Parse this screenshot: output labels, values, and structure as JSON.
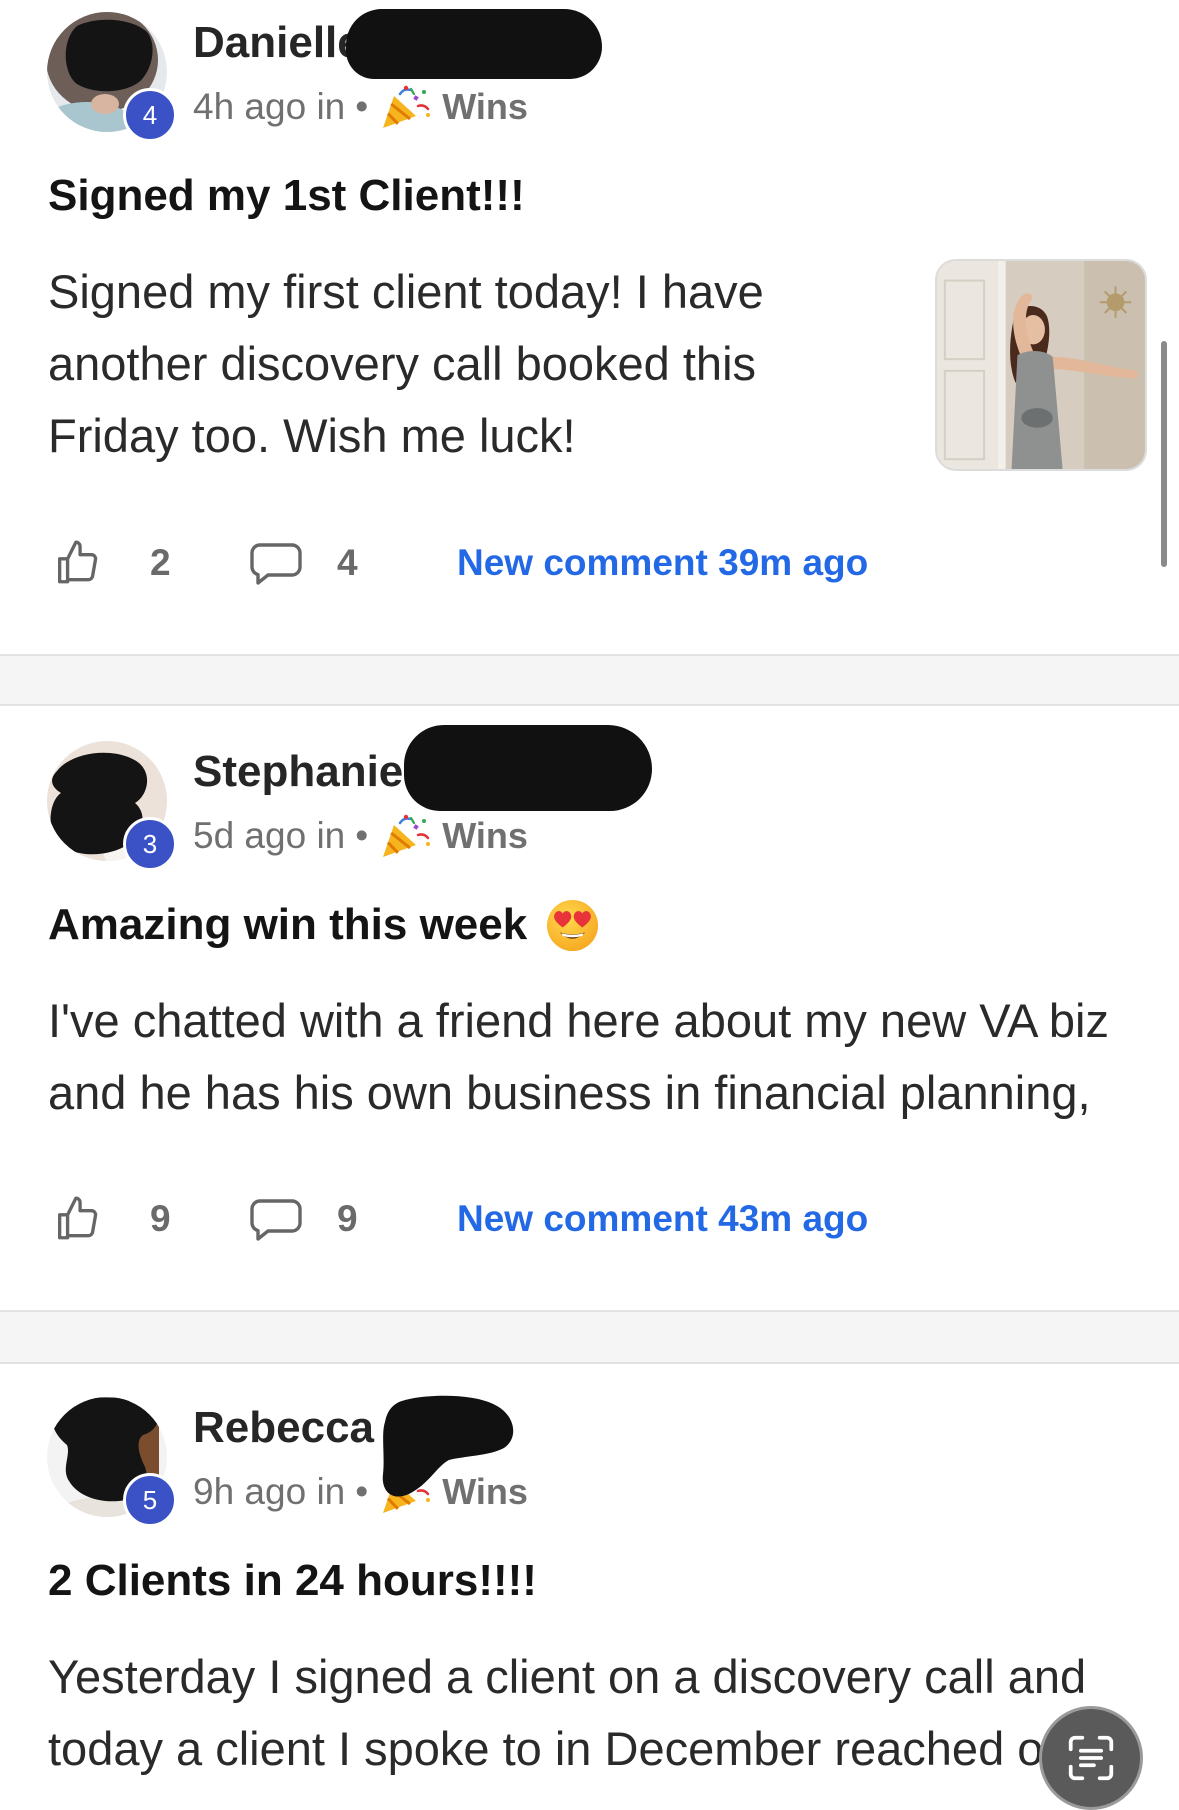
{
  "feed": {
    "posts": [
      {
        "author": "Danielle",
        "level": "4",
        "time": "4h ago in",
        "separator": "•",
        "category": "Wins",
        "title": "Signed my 1st Client!!!",
        "body_lines": [
          "Signed my first client today! I have",
          "another discovery call booked this",
          "Friday too. Wish me luck!"
        ],
        "likes": "2",
        "comments": "4",
        "new_comment": "New comment 39m ago"
      },
      {
        "author": "Stephanie",
        "level": "3",
        "time": "5d ago in",
        "separator": "•",
        "category": "Wins",
        "title": "Amazing win this week",
        "body_lines": [
          "I've chatted with a friend here about my new VA biz",
          "and he has his own business in financial planning,"
        ],
        "likes": "9",
        "comments": "9",
        "new_comment": "New comment 43m ago"
      },
      {
        "author": "Rebecca",
        "level": "5",
        "time": "9h ago in",
        "separator": "•",
        "category": "Wins",
        "title": "2 Clients in 24 hours!!!!",
        "body_lines": [
          "Yesterday I signed a client on a discovery call and",
          "today a client I spoke to in December reached o"
        ]
      }
    ]
  },
  "icons": {
    "category": "party-popper-icon",
    "title_emoji": "smiling-face-with-heart-eyes-icon",
    "like": "thumbs-up-icon",
    "comment": "comment-bubble-icon",
    "floating_button": "live-text-scan-icon"
  },
  "colors": {
    "link": "#2369e6",
    "badge": "#3a52c5",
    "title": "#141414",
    "meta": "#707070",
    "body": "#2a2a2a",
    "icon": "#6a6a6a",
    "redact": "#111111",
    "fab": "#5a5a5a"
  }
}
